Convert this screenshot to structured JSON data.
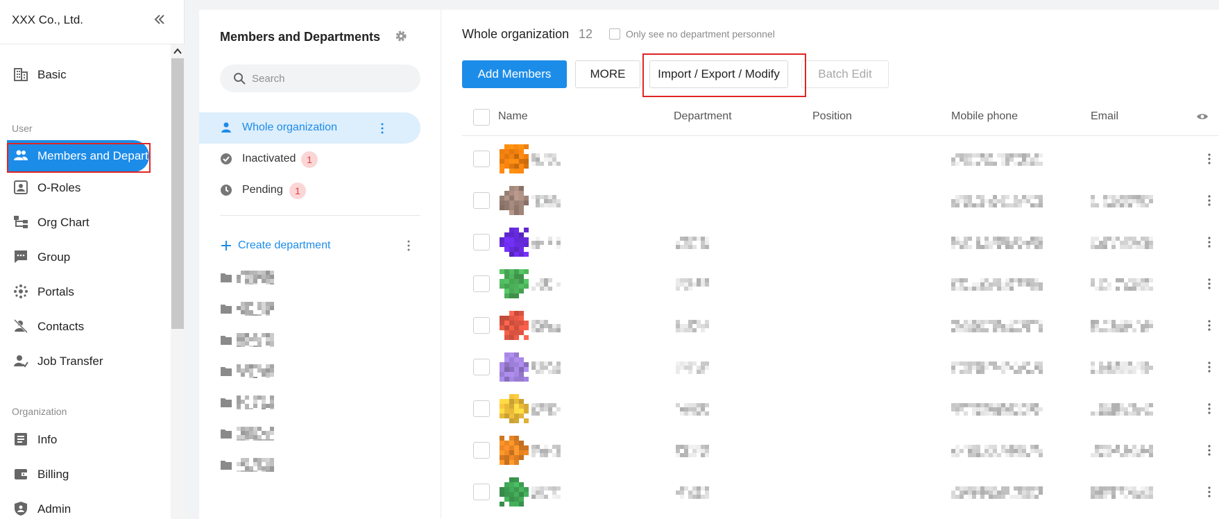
{
  "sidebar": {
    "company": "XXX Co., Ltd.",
    "items": [
      {
        "label": "Basic",
        "icon": "building-icon"
      },
      {
        "label": "Members and Departments",
        "icon": "users-icon"
      },
      {
        "label": "O-Roles",
        "icon": "id-card-icon"
      },
      {
        "label": "Org Chart",
        "icon": "org-chart-icon"
      },
      {
        "label": "Group",
        "icon": "chat-icon"
      },
      {
        "label": "Portals",
        "icon": "portal-icon"
      },
      {
        "label": "Contacts",
        "icon": "contacts-icon"
      },
      {
        "label": "Job Transfer",
        "icon": "job-transfer-icon"
      },
      {
        "label": "Info",
        "icon": "info-icon"
      },
      {
        "label": "Billing",
        "icon": "wallet-icon"
      },
      {
        "label": "Admin",
        "icon": "shield-user-icon"
      }
    ],
    "sections": {
      "user": "User",
      "organization": "Organization"
    },
    "active_index": 1
  },
  "panel": {
    "title": "Members and Departments",
    "search_placeholder": "Search",
    "filters": [
      {
        "label": "Whole organization",
        "icon": "person-icon",
        "badge": null
      },
      {
        "label": "Inactivated",
        "icon": "check-circle-icon",
        "badge": "1"
      },
      {
        "label": "Pending",
        "icon": "clock-icon",
        "badge": "1"
      }
    ],
    "create_department": "Create department",
    "department_count_rows": 7
  },
  "main": {
    "title": "Whole organization",
    "count": "12",
    "only_no_department": "Only see no department personnel",
    "buttons": {
      "add": "Add Members",
      "more": "MORE",
      "import": "Import / Export / Modify",
      "batch": "Batch Edit"
    },
    "columns": {
      "name": "Name",
      "department": "Department",
      "position": "Position",
      "mobile": "Mobile phone",
      "email": "Email"
    },
    "rows": [
      {
        "avatar_color": "#f5820f",
        "has_department": false,
        "has_email": false
      },
      {
        "avatar_color": "#a2877b",
        "has_department": false,
        "has_email": true
      },
      {
        "avatar_color": "#6a2ce6",
        "has_department": true,
        "has_email": true
      },
      {
        "avatar_color": "#4cb15a",
        "has_department": true,
        "has_email": true
      },
      {
        "avatar_color": "#ea5a45",
        "has_department": true,
        "has_email": true
      },
      {
        "avatar_color": "#9c7fd6",
        "has_department": true,
        "has_email": true
      },
      {
        "avatar_color": "#f7c53d",
        "has_department": true,
        "has_email": true
      },
      {
        "avatar_color": "#f38a26",
        "has_department": true,
        "has_email": true
      },
      {
        "avatar_color": "#42a857",
        "has_department": true,
        "has_email": true
      }
    ]
  },
  "colors": {
    "accent": "#1c8ce9",
    "highlight": "#e02424",
    "badge_bg": "#fbd6d6",
    "badge_text": "#e23b3b"
  }
}
